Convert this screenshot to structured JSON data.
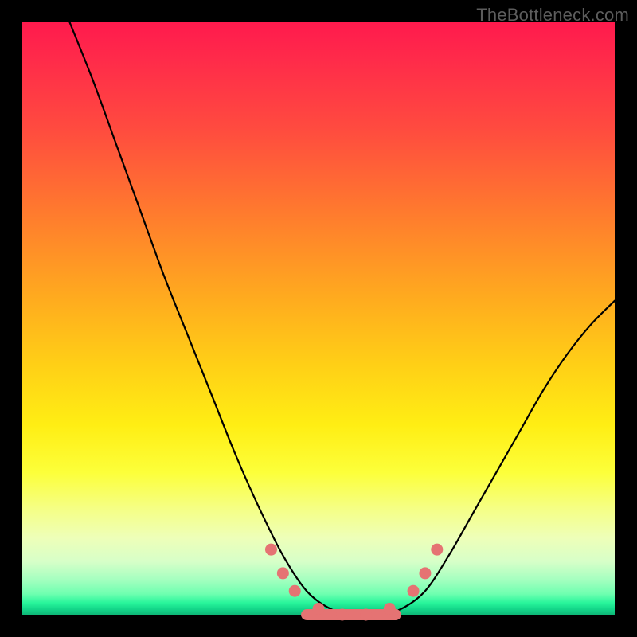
{
  "watermark": "TheBottleneck.com",
  "chart_data": {
    "type": "line",
    "title": "",
    "xlabel": "",
    "ylabel": "",
    "xlim": [
      0,
      100
    ],
    "ylim": [
      0,
      100
    ],
    "grid": false,
    "legend": false,
    "gradient_stops": [
      {
        "pos": 0.0,
        "color": "#ff1a4d"
      },
      {
        "pos": 0.18,
        "color": "#ff4b3f"
      },
      {
        "pos": 0.46,
        "color": "#ffa91f"
      },
      {
        "pos": 0.68,
        "color": "#ffee14"
      },
      {
        "pos": 0.87,
        "color": "#eeffb8"
      },
      {
        "pos": 0.96,
        "color": "#6effb0"
      },
      {
        "pos": 1.0,
        "color": "#0eb877"
      }
    ],
    "series": [
      {
        "name": "bottleneck-curve",
        "x": [
          8,
          12,
          16,
          20,
          24,
          28,
          32,
          36,
          40,
          44,
          48,
          52,
          56,
          60,
          64,
          68,
          72,
          76,
          80,
          84,
          88,
          92,
          96,
          100
        ],
        "y": [
          100,
          90,
          79,
          68,
          57,
          47,
          37,
          27,
          18,
          10,
          4,
          1,
          0,
          0,
          1,
          4,
          10,
          17,
          24,
          31,
          38,
          44,
          49,
          53
        ]
      }
    ],
    "markers": {
      "name": "highlight-dots",
      "color": "#e57373",
      "points": [
        {
          "x": 42,
          "y": 11
        },
        {
          "x": 44,
          "y": 7
        },
        {
          "x": 46,
          "y": 4
        },
        {
          "x": 50,
          "y": 1
        },
        {
          "x": 54,
          "y": 0
        },
        {
          "x": 58,
          "y": 0
        },
        {
          "x": 62,
          "y": 1
        },
        {
          "x": 66,
          "y": 4
        },
        {
          "x": 68,
          "y": 7
        },
        {
          "x": 70,
          "y": 11
        }
      ]
    },
    "baseline_segment": {
      "color": "#e57373",
      "x_start": 48,
      "x_end": 63,
      "y": 0
    }
  }
}
